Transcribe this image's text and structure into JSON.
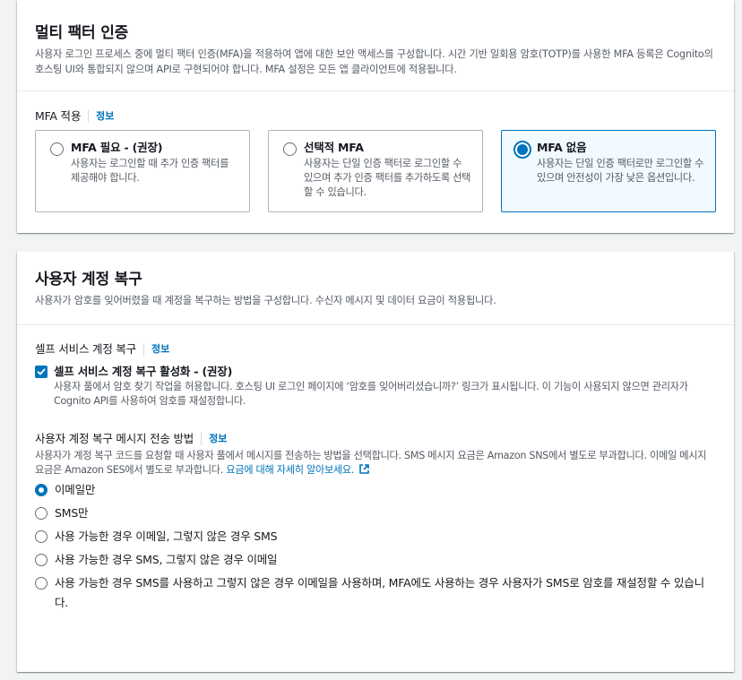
{
  "mfa": {
    "title": "멀티 팩터 인증",
    "description": "사용자 로그인 프로세스 중에 멀티 팩터 인증(MFA)을 적용하여 앱에 대한 보안 액세스를 구성합니다. 시간 기반 일회용 암호(TOTP)를 사용한 MFA 등록은 Cognito의 호스팅 UI와 통합되지 않으며 API로 구현되어야 합니다. MFA 설정은 모든 앱 클라이언트에 적용됩니다.",
    "enforcement_label": "MFA 적용",
    "info_label": "정보",
    "options": [
      {
        "title": "MFA 필요 - (권장)",
        "description": "사용자는 로그인할 때 추가 인증 팩터를 제공해야 합니다.",
        "selected": false
      },
      {
        "title": "선택적 MFA",
        "description": "사용자는 단일 인증 팩터로 로그인할 수 있으며 추가 인증 팩터를 추가하도록 선택할 수 있습니다.",
        "selected": false
      },
      {
        "title": "MFA 없음",
        "description": "사용자는 단일 인증 팩터로만 로그인할 수 있으며 안전성이 가장 낮은 옵션입니다.",
        "selected": true
      }
    ]
  },
  "recovery": {
    "title": "사용자 계정 복구",
    "description": "사용자가 암호를 잊어버렸을 때 계정을 복구하는 방법을 구성합니다. 수신자 메시지 및 데이터 요금이 적용됩니다.",
    "self_service_label": "셀프 서비스 계정 복구",
    "info_label": "정보",
    "self_service_checkbox": {
      "title": "셀프 서비스 계정 복구 활성화 - (권장)",
      "description": "사용자 풀에서 암호 찾기 작업을 허용합니다. 호스팅 UI 로그인 페이지에 ‘암호를 잊어버리셨습니까?’ 링크가 표시됩니다. 이 기능이 사용되지 않으면 관리자가 Cognito API를 사용하여 암호를 재설정합니다.",
      "checked": true
    },
    "delivery_label": "사용자 계정 복구 메시지 전송 방법",
    "delivery_description": "사용자가 계정 복구 코드를 요청할 때 사용자 풀에서 메시지를 전송하는 방법을 선택합니다. SMS 메시지 요금은 Amazon SNS에서 별도로 부과합니다. 이메일 메시지 요금은 Amazon SES에서 별도로 부과합니다.",
    "pricing_link": "요금에 대해 자세히 알아보세요.",
    "delivery_options": [
      {
        "label": "이메일만",
        "selected": true
      },
      {
        "label": "SMS만",
        "selected": false
      },
      {
        "label": "사용 가능한 경우 이메일, 그렇지 않은 경우 SMS",
        "selected": false
      },
      {
        "label": "사용 가능한 경우 SMS, 그렇지 않은 경우 이메일",
        "selected": false
      },
      {
        "label": "사용 가능한 경우 SMS를 사용하고 그렇지 않은 경우 이메일을 사용하며, MFA에도 사용하는 경우 사용자가 SMS로 암호를 재설정할 수 있습니다.",
        "selected": false
      }
    ]
  },
  "icons": {
    "external_link": "external-link-icon",
    "checkbox": "check-icon"
  },
  "colors": {
    "accent": "#0073bb",
    "selected_tile_bg": "#f1faff",
    "background": "#f2f3f3"
  }
}
